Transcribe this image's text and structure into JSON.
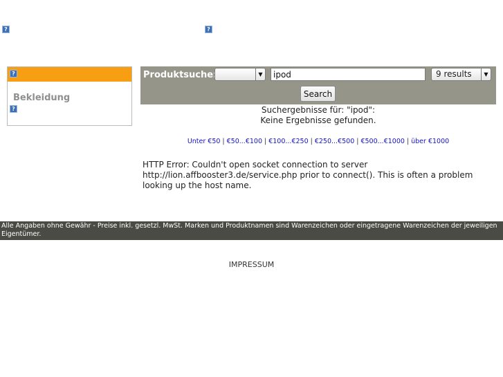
{
  "top_images": {
    "img1_glyph": "?",
    "img2_glyph": "?"
  },
  "sidebar": {
    "head_glyph": "?",
    "link": "Bekleidung",
    "img_glyph": "?",
    "header_color": "#f89e12"
  },
  "search": {
    "label": "Produktsuche:",
    "category_value": "",
    "query_value": "ipod",
    "results_value": "9 results",
    "button_label": "Search",
    "bar_color": "#95958a"
  },
  "results": {
    "results_for": "Suchergebnisse für: \"ipod\":",
    "no_results": "Keine Ergebnisse gefunden."
  },
  "price_ranges": [
    "Unter €50",
    "€50...€100",
    "€100...€250",
    "€250...€500",
    "€500...€1000",
    "über €1000"
  ],
  "price_separator": "|",
  "error": "HTTP Error: Couldn't open socket connection to server http://lion.affbooster3.de/service.php prior to connect(). This is often a problem looking up the host name.",
  "footer": {
    "disclaimer": "Alle Angaben ohne Gewähr - Preise inkl. gesetzl. MwSt. Marken und Produktnamen sind Warenzeichen oder eingetragene Warenzeichen der jeweiligen Eigentümer.",
    "impressum": "IMPRESSUM"
  }
}
